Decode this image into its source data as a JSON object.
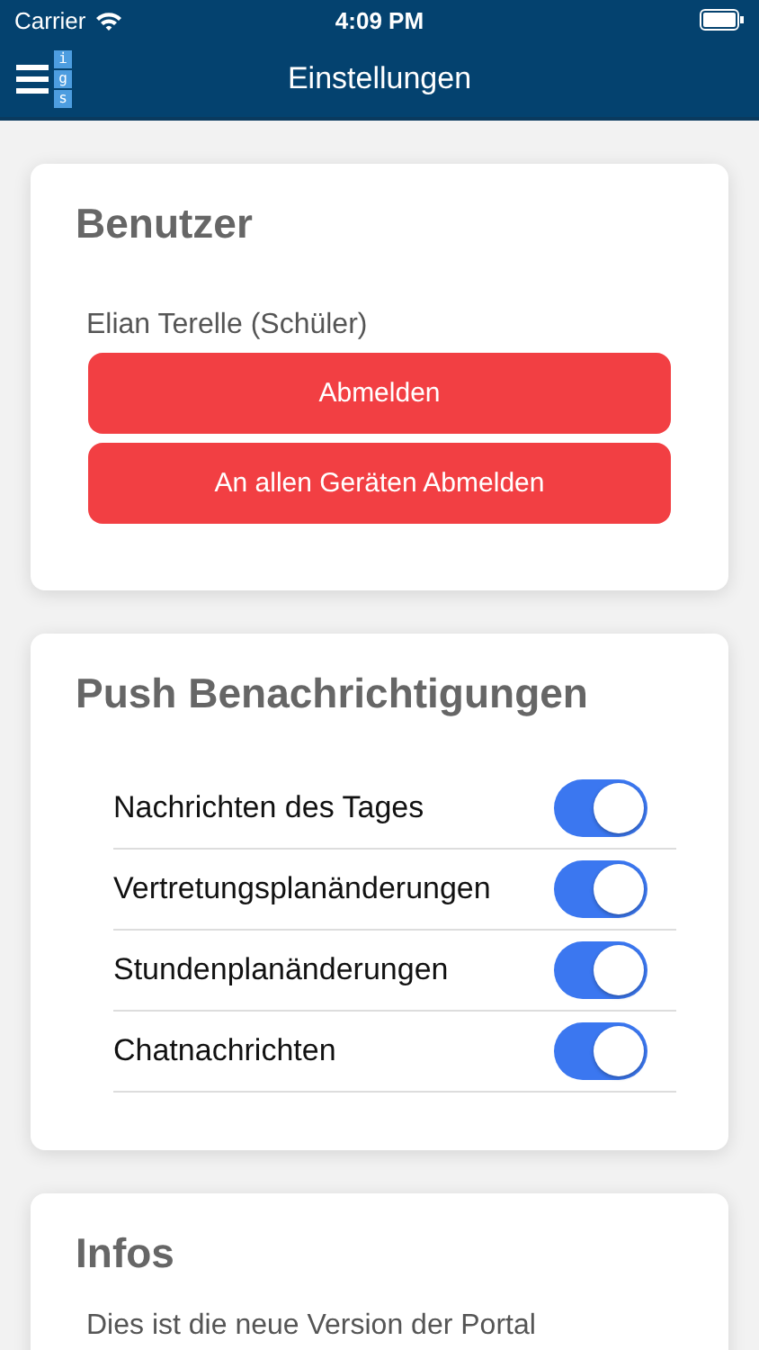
{
  "status_bar": {
    "carrier": "Carrier",
    "time": "4:09 PM"
  },
  "nav": {
    "logo_letters": [
      "i",
      "g",
      "s"
    ],
    "title": "Einstellungen"
  },
  "user_card": {
    "title": "Benutzer",
    "user": "Elian Terelle (Schüler)",
    "buttons": [
      "Abmelden",
      "An allen Geräten Abmelden"
    ]
  },
  "push_card": {
    "title": "Push Benachrichtigungen",
    "toggles": [
      {
        "label": "Nachrichten des Tages",
        "on": true
      },
      {
        "label": "Vertretungsplanänderungen",
        "on": true
      },
      {
        "label": "Stundenplanänderungen",
        "on": true
      },
      {
        "label": "Chatnachrichten",
        "on": true
      }
    ]
  },
  "info_card": {
    "title": "Infos",
    "text": "Dies ist die neue Version der Portal"
  }
}
